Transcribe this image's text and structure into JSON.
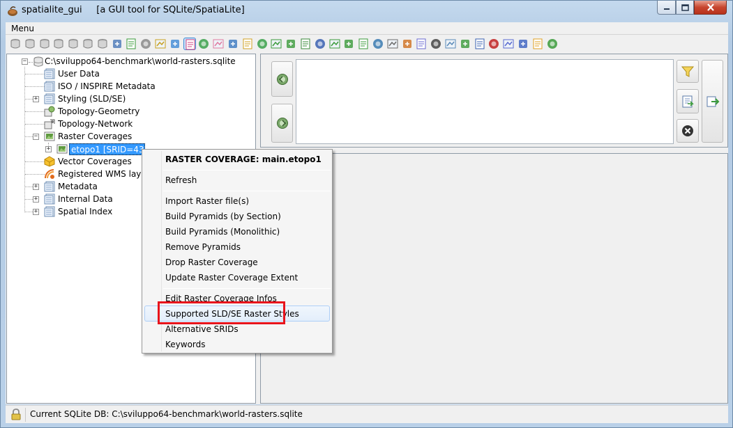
{
  "window": {
    "title": "spatialite_gui",
    "subtitle": "[a GUI tool for SQLite/SpatiaLite]"
  },
  "menu": {
    "label": "Menu"
  },
  "toolbar": {
    "icons": [
      "connect-icon",
      "disconnect-icon",
      "create-db-icon",
      "memory-db-icon",
      "memory-db-load-icon",
      "memory-db-save-icon",
      "memory-db-clone-icon",
      "vacuum-icon",
      "sql-script-icon",
      "load-shapefile-icon",
      "virtual-shapefile-icon",
      "load-txt-icon",
      "virtual-txt-icon",
      "load-dbf-icon",
      "load-xl-icon",
      "network-icon",
      "export-icon",
      "help-icon",
      "exit-icon"
    ]
  },
  "tree": {
    "root": "C:\\sviluppo64-benchmark\\world-rasters.sqlite",
    "items": {
      "user_data": "User Data",
      "iso_metadata": "ISO / INSPIRE Metadata",
      "styling": "Styling (SLD/SE)",
      "topo_geometry": "Topology-Geometry",
      "topo_network": "Topology-Network",
      "raster_coverages": "Raster Coverages",
      "etopo1": "etopo1 [SRID=4326]",
      "vector_coverages": "Vector Coverages",
      "wms_layers": "Registered WMS layers",
      "metadata": "Metadata",
      "internal_data": "Internal Data",
      "spatial_index": "Spatial Index"
    }
  },
  "context_menu": {
    "header": "RASTER COVERAGE: main.etopo1",
    "refresh": "Refresh",
    "import_raster": "Import Raster file(s)",
    "build_pyramids_section": "Build Pyramids (by Section)",
    "build_pyramids_mono": "Build Pyramids (Monolithic)",
    "remove_pyramids": "Remove Pyramids",
    "drop_coverage": "Drop Raster Coverage",
    "update_extent": "Update Raster Coverage Extent",
    "edit_infos": "Edit Raster Coverage Infos",
    "supported_styles": "Supported SLD/SE Raster Styles",
    "alt_srids": "Alternative SRIDs",
    "keywords": "Keywords"
  },
  "status": {
    "text": "Current SQLite DB: C:\\sviluppo64-benchmark\\world-rasters.sqlite"
  },
  "colors": {
    "selection": "#3399ff",
    "highlight_box": "#e8141c",
    "title_bar": "#b9d1ea"
  }
}
